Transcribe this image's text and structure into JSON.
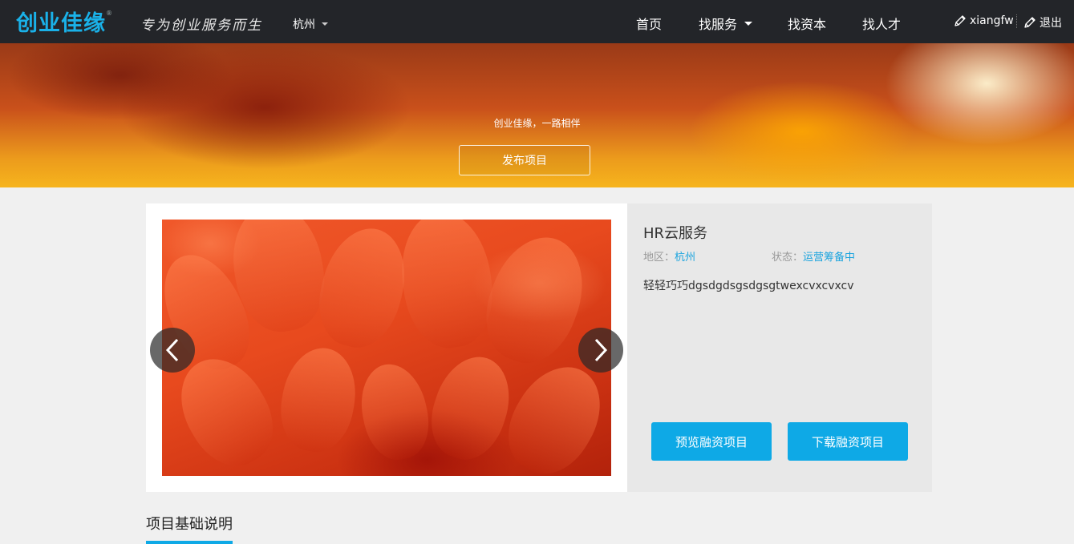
{
  "header": {
    "logo_text": "创业佳缘",
    "logo_reg": "®",
    "slogan": "专为创业服务而生",
    "city": "杭州",
    "nav": {
      "home": "首页",
      "services": "找服务",
      "capital": "找资本",
      "talent": "找人才"
    },
    "username": "xiangfw",
    "logout": "退出"
  },
  "banner": {
    "subtitle": "创业佳缘，一路相伴",
    "publish_button": "发布项目"
  },
  "project": {
    "title": "HR云服务",
    "region_label": "地区：",
    "region_value": "杭州",
    "status_label": "状态：",
    "status_value": "运营筹备中",
    "description": "轻轻巧巧dgsdgdsgsdgsgtwexcvxcvxcv",
    "preview_button": "预览融资项目",
    "download_button": "下载融资项目"
  },
  "section": {
    "title": "项目基础说明"
  },
  "colors": {
    "accent": "#0ea9e6",
    "header_bg": "#232529",
    "logo": "#1ab1e8"
  }
}
